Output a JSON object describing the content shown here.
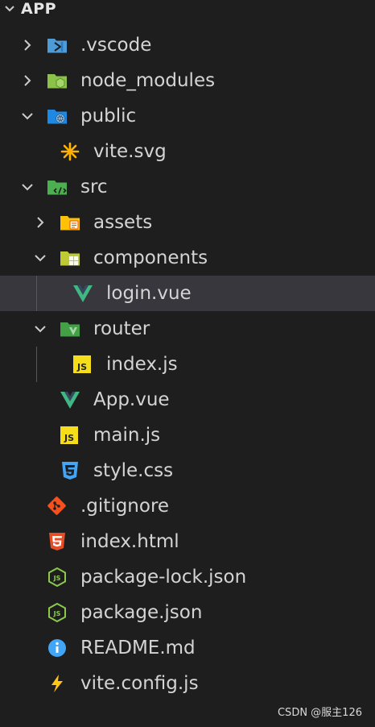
{
  "explorer": {
    "root_label": "APP",
    "items": [
      {
        "label": ".vscode",
        "type": "folder",
        "icon": "vscode-folder-icon",
        "expanded": false,
        "depth": 0
      },
      {
        "label": "node_modules",
        "type": "folder",
        "icon": "node-modules-folder-icon",
        "expanded": false,
        "depth": 0
      },
      {
        "label": "public",
        "type": "folder",
        "icon": "public-folder-icon",
        "expanded": true,
        "depth": 0
      },
      {
        "label": "vite.svg",
        "type": "file",
        "icon": "svg-file-icon",
        "depth": 1
      },
      {
        "label": "src",
        "type": "folder",
        "icon": "src-folder-icon",
        "expanded": true,
        "depth": 0
      },
      {
        "label": "assets",
        "type": "folder",
        "icon": "assets-folder-icon",
        "expanded": false,
        "depth": 1
      },
      {
        "label": "components",
        "type": "folder",
        "icon": "components-folder-icon",
        "expanded": true,
        "depth": 1
      },
      {
        "label": "login.vue",
        "type": "file",
        "icon": "vue-file-icon",
        "depth": 2,
        "selected": true
      },
      {
        "label": "router",
        "type": "folder",
        "icon": "router-folder-icon",
        "expanded": true,
        "depth": 1
      },
      {
        "label": "index.js",
        "type": "file",
        "icon": "js-file-icon",
        "depth": 2
      },
      {
        "label": "App.vue",
        "type": "file",
        "icon": "vue-file-icon",
        "depth": 1
      },
      {
        "label": "main.js",
        "type": "file",
        "icon": "js-file-icon",
        "depth": 1
      },
      {
        "label": "style.css",
        "type": "file",
        "icon": "css-file-icon",
        "depth": 1
      },
      {
        "label": ".gitignore",
        "type": "file",
        "icon": "git-file-icon",
        "depth": 0
      },
      {
        "label": "index.html",
        "type": "file",
        "icon": "html-file-icon",
        "depth": 0
      },
      {
        "label": "package-lock.json",
        "type": "file",
        "icon": "nodejs-file-icon",
        "depth": 0
      },
      {
        "label": "package.json",
        "type": "file",
        "icon": "nodejs-file-icon",
        "depth": 0
      },
      {
        "label": "README.md",
        "type": "file",
        "icon": "info-file-icon",
        "depth": 0
      },
      {
        "label": "vite.config.js",
        "type": "file",
        "icon": "vite-file-icon",
        "depth": 0
      }
    ]
  },
  "watermark": "CSDN @服主126",
  "colors": {
    "background": "#1e1e1e",
    "selected_row": "#37373d",
    "text": "#d4d4d4",
    "vue_green": "#41b883",
    "js_yellow": "#f5de19",
    "css_blue": "#42a5f5",
    "html_orange": "#e44d26",
    "node_green": "#8cc84b",
    "vite_yellow": "#ffc517"
  }
}
